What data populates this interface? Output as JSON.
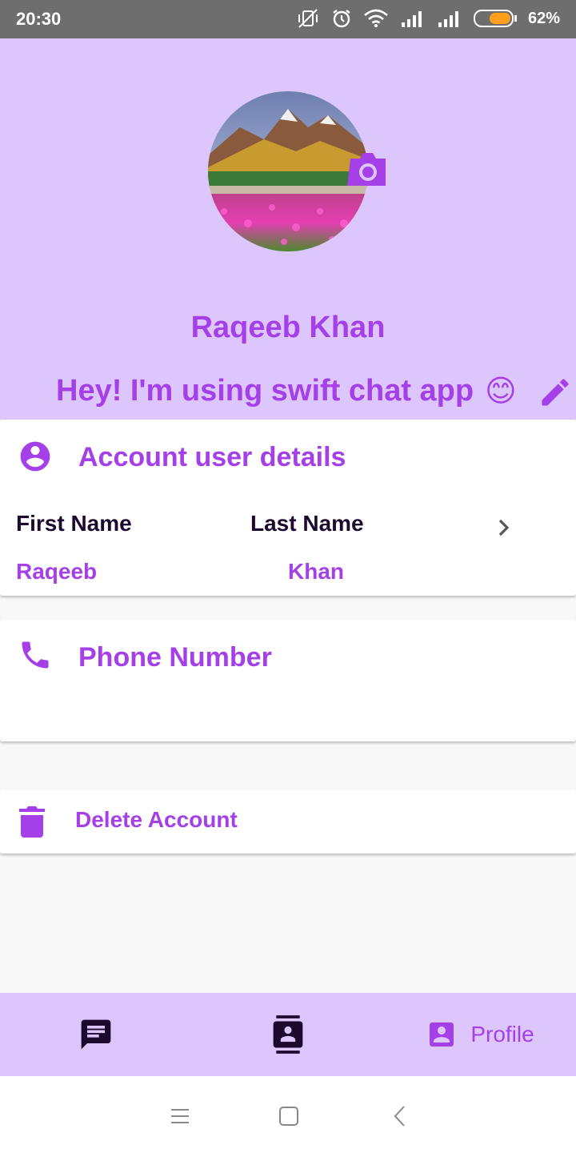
{
  "status_bar": {
    "time": "20:30",
    "battery": "62%"
  },
  "profile": {
    "name": "Raqeeb Khan",
    "status": "Hey! I'm using swift chat app",
    "status_emoji": "😊"
  },
  "account_card": {
    "title": "Account user details",
    "first_name_label": "First Name",
    "last_name_label": "Last Name",
    "first_name_value": "Raqeeb",
    "last_name_value": "Khan"
  },
  "phone_card": {
    "title": "Phone Number"
  },
  "delete_card": {
    "label": "Delete Account"
  },
  "bottom_nav": {
    "profile_label": "Profile"
  },
  "colors": {
    "accent": "#a53fe8",
    "header_bg": "#dcc6fb",
    "dark_text": "#1c0a2e"
  },
  "icons": [
    "camera-icon",
    "edit-icon",
    "account-circle-icon",
    "phone-icon",
    "delete-icon",
    "chevron-right-icon",
    "chat-icon",
    "contacts-icon",
    "profile-icon"
  ]
}
